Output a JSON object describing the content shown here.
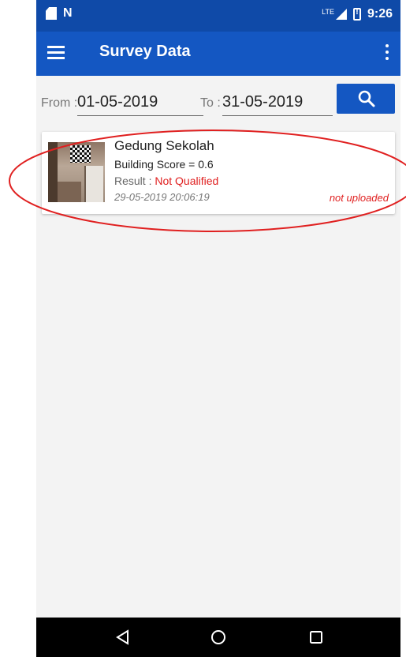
{
  "status_bar": {
    "network": "LTE",
    "time": "9:26",
    "icons": [
      "sim-card-icon",
      "n-notification-icon",
      "lte-signal-icon",
      "battery-alert-icon"
    ]
  },
  "app_bar": {
    "title": "Survey Data",
    "icons": [
      "menu-icon",
      "more-vert-icon"
    ]
  },
  "filter": {
    "from_label": "From :",
    "from_value": "01-05-2019",
    "to_label": "To :",
    "to_value": "31-05-2019",
    "search_icon": "search-icon"
  },
  "surveys": [
    {
      "title": "Gedung Sekolah",
      "score_text": "Building Score = 0.6",
      "result_label": "Result : ",
      "result_value": "Not Qualified",
      "datetime": "29-05-2019 20:06:19",
      "upload_status": "not uploaded"
    }
  ],
  "nav_bar": {
    "icons": [
      "back-icon",
      "home-icon",
      "recents-icon"
    ]
  },
  "colors": {
    "primary": "#1457c2",
    "status_bar": "#0f4aa8",
    "error": "#e02020",
    "highlight_ellipse": "#e02020"
  }
}
